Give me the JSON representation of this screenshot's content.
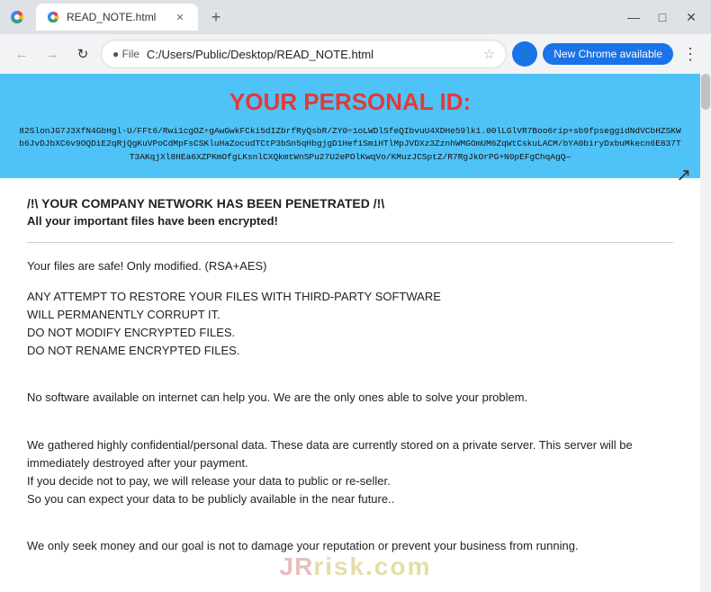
{
  "browser": {
    "tab": {
      "title": "READ_NOTE.html",
      "favicon_color": "#4285f4"
    },
    "address": {
      "protocol": "File",
      "url": "C:/Users/Public/Desktop/READ_NOTE.html"
    },
    "new_chrome_button": "New Chrome available",
    "window_controls": {
      "minimize": "—",
      "maximize": "□",
      "close": "✕"
    }
  },
  "page": {
    "header": {
      "title": "YOUR PERSONAL ID:",
      "id_code": "82SlonJG7J3XfN4GbHgl·U/FFt6/Rwi1cgOZ÷gAwGwkFCki5dIZbrfRyQsbR/ZY0÷1oLWDlSfeQIbvuU4XDHe59lk1.00lLGlVR7Boo6rip+sb9fpseggidNdVCbHZSKWb6JvDJbXC6v9OQDiE2qRjQgKuVPoCdMpFsCSKluHaZocudTCtP3bSn5qHbgjgD1Hef1SmiHTlMpJVDXz3ZznhWMGOmUM6ZqWtCskuLACM/bYA0biryDxbuMkecn6E837TT3AKqjXl8HEa6XZPKmOfgLKsnlCXQkmtWnSPu27U2ePOlKwqVo/KMuzJCSptZ/R7RgJkOrPG+N0pEFgChqAgQ—"
    },
    "body": {
      "warning_title": "/!\\ YOUR COMPANY NETWORK HAS BEEN PENETRATED /!\\",
      "warning_subtitle": "All your important files have been encrypted!",
      "paragraphs": [
        "Your files are safe! Only modified. (RSA+AES)",
        "ANY ATTEMPT TO RESTORE YOUR FILES WITH THIRD-PARTY SOFTWARE\nWILL PERMANENTLY CORRUPT IT.\nDO NOT MODIFY ENCRYPTED FILES.\nDO NOT RENAME ENCRYPTED FILES.",
        "No software available on internet can help you. We are the only ones able to solve your problem.",
        "We gathered highly confidential/personal data. These data are currently stored on a private server. This server will be immediately destroyed after your payment.\nIf you decide not to pay, we will release your data to public or re-seller.\nSo you can expect your data to be publicly available in the near future..",
        "We only seek money and our goal is not to damage your reputation or prevent your business from running."
      ]
    },
    "watermark": {
      "text1": "JR",
      "text2": "risk.com"
    }
  }
}
